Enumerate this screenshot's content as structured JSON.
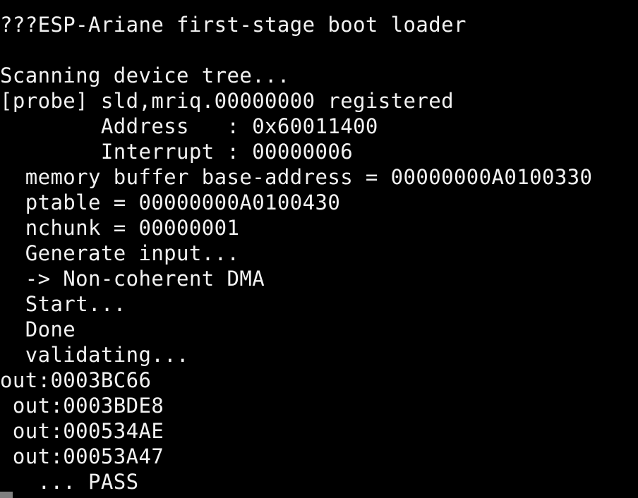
{
  "colors": {
    "background": "#000000",
    "text": "#f2f2f2",
    "cursor": "#7f7f7f"
  },
  "terminal": {
    "lines": [
      "???ESP-Ariane first-stage boot loader",
      "",
      "Scanning device tree...",
      "[probe] sld,mriq.00000000 registered",
      "        Address   : 0x60011400",
      "        Interrupt : 00000006",
      "  memory buffer base-address = 00000000A0100330",
      "  ptable = 00000000A0100430",
      "  nchunk = 00000001",
      "  Generate input...",
      "  -> Non-coherent DMA",
      "  Start...",
      "  Done",
      "  validating...",
      "out:0003BC66",
      " out:0003BDE8",
      " out:000534AE",
      " out:00053A47",
      "   ... PASS"
    ]
  }
}
